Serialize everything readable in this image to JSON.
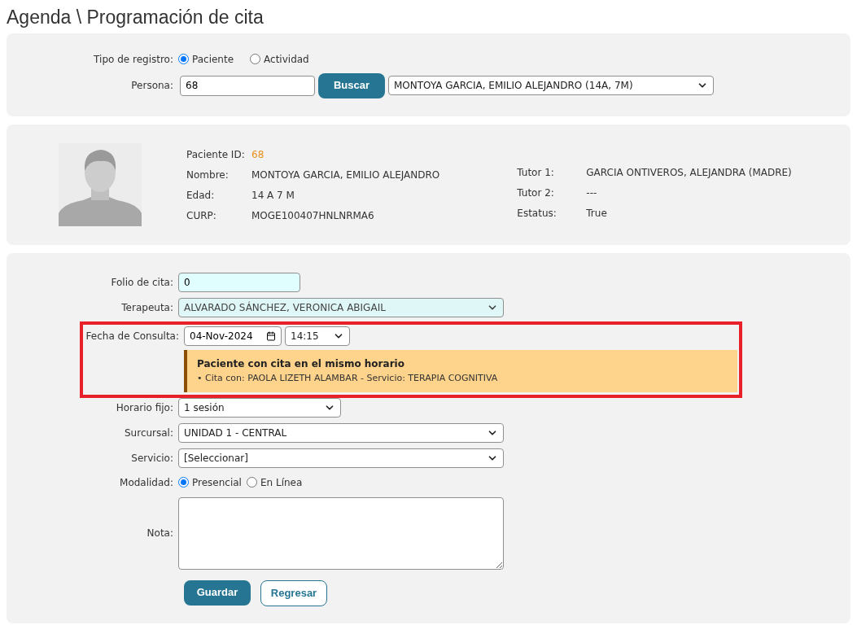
{
  "title": "Agenda \\ Programación de cita",
  "search": {
    "tipo_label": "Tipo de registro:",
    "tipo_options": [
      {
        "label": "Paciente",
        "selected": true
      },
      {
        "label": "Actividad",
        "selected": false
      }
    ],
    "persona_label": "Persona:",
    "persona_value": "68",
    "search_button": "Buscar",
    "persona_select": "MONTOYA GARCIA, EMILIO ALEJANDRO (14A, 7M)"
  },
  "patient": {
    "left": [
      {
        "label": "Paciente ID:",
        "value": "68",
        "kind": "highlight"
      },
      {
        "label": "Nombre:",
        "value": "MONTOYA GARCIA, EMILIO ALEJANDRO",
        "kind": "plain"
      },
      {
        "label": "Edad:",
        "value": "14 A 7 M",
        "kind": "plain"
      },
      {
        "label": "CURP:",
        "value": "MOGE100407HNLNRMA6",
        "kind": "plain"
      }
    ],
    "right": [
      {
        "label": "Tutor 1:",
        "value": "GARCIA ONTIVEROS, ALEJANDRA (MADRE)"
      },
      {
        "label": "Tutor 2:",
        "value": "---"
      },
      {
        "label": "Estatus:",
        "value": "True"
      }
    ]
  },
  "form": {
    "folio_label": "Folio de cita:",
    "folio_value": "0",
    "terapeuta_label": "Terapeuta:",
    "terapeuta_value": "ALVARADO SÁNCHEZ, VERONICA ABIGAIL",
    "fecha_label": "Fecha de Consulta:",
    "fecha_value": "04-Nov-2024",
    "hora_value": "14:15",
    "alert": {
      "title": "Paciente con cita en el mismo horario",
      "detail": "• Cita con: PAOLA LIZETH ALAMBAR - Servicio: TERAPIA COGNITIVA"
    },
    "horario_label": "Horario fijo:",
    "horario_value": "1 sesión",
    "sucursal_label": "Surcursal:",
    "sucursal_value": "UNIDAD 1 - CENTRAL",
    "servicio_label": "Servicio:",
    "servicio_value": "[Seleccionar]",
    "modalidad_label": "Modalidad:",
    "modalidad_options": [
      {
        "label": "Presencial",
        "selected": true
      },
      {
        "label": "En Línea",
        "selected": false
      }
    ],
    "nota_label": "Nota:",
    "save_button": "Guardar",
    "back_button": "Regresar"
  }
}
